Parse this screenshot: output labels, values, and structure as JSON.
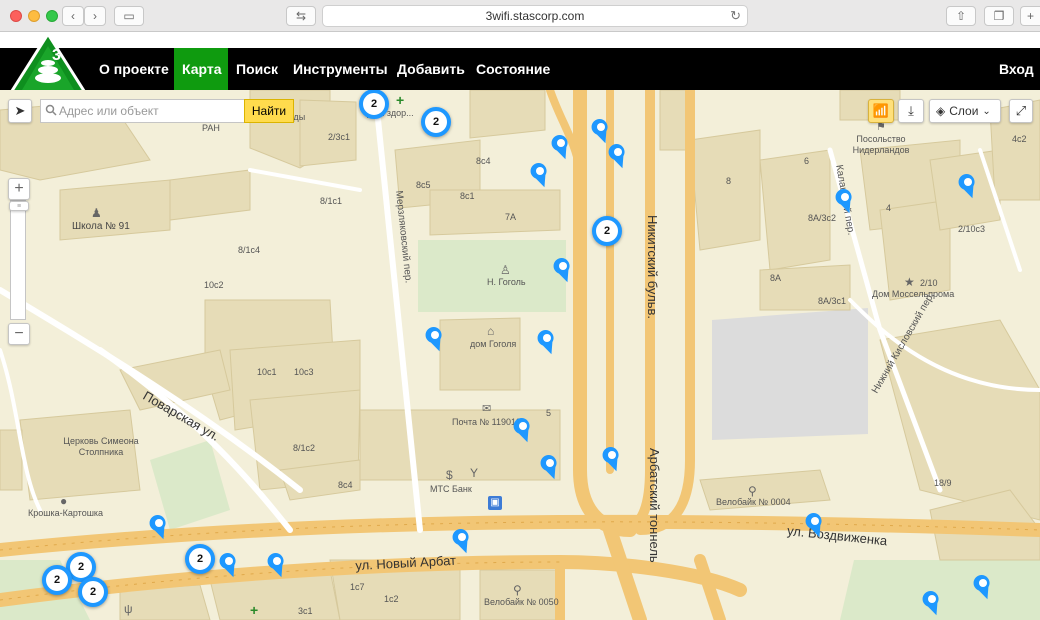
{
  "browser": {
    "url": "3wifi.stascorp.com"
  },
  "nav": {
    "items": [
      {
        "label": "О проекте"
      },
      {
        "label": "Карта"
      },
      {
        "label": "Поиск"
      },
      {
        "label": "Инструменты"
      },
      {
        "label": "Добавить"
      },
      {
        "label": "Состояние"
      }
    ],
    "login": "Вход"
  },
  "map": {
    "search_placeholder": "Адрес или объект",
    "search_button": "Найти",
    "layers_label": "Слои",
    "streets": [
      "Поварская ул.",
      "ул. Новый Арбат",
      "ул. Воздвиженка",
      "Никитский бульв.",
      "Арбатский тоннель",
      "Мерзляковский пер.",
      "Калашный пер.",
      "Нижний Кисловский пер."
    ],
    "labels": [
      "Школа № 91",
      "Н. Гоголь",
      "дом Гоголя",
      "Почта № 119019",
      "МТС Банк",
      "Церковь Симеона Столпника",
      "Крошка-Картошка",
      "Велобайк № 0004",
      "Велобайк № 0050",
      "Посольство Нидерландов",
      "Дом Моссельпрома",
      "Институт США и Канады РАН",
      "Дом здор...",
      "2/3с1",
      "8с4",
      "8с5",
      "8с1",
      "7А",
      "8/1с1",
      "8/1с4",
      "10с2",
      "10с1",
      "10с3",
      "8/1с2",
      "8с4",
      "5",
      "8",
      "6",
      "8А/3с2",
      "8А",
      "8А/3с1",
      "4",
      "4с2",
      "2/10с3",
      "2/10",
      "18/9",
      "1с7",
      "1с2",
      "3с1"
    ],
    "clusters": [
      2,
      2,
      2,
      2,
      2,
      2,
      2
    ]
  }
}
